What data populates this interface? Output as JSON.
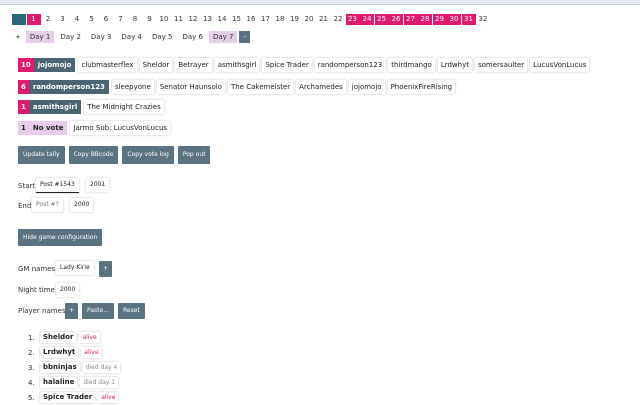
{
  "pages": [
    "1",
    "1",
    "2",
    "3",
    "4",
    "5",
    "6",
    "7",
    "8",
    "9",
    "10",
    "11",
    "12",
    "13",
    "14",
    "15",
    "16",
    "17",
    "18",
    "19",
    "20",
    "21",
    "22",
    "23",
    "24",
    "25",
    "26",
    "27",
    "28",
    "29",
    "30",
    "31",
    "32"
  ],
  "days": {
    "plus": "+",
    "minus": "-",
    "items": [
      "Day 1",
      "Day 2",
      "Day 3",
      "Day 4",
      "Day 5",
      "Day 6",
      "Day 7"
    ]
  },
  "votes": [
    {
      "count": "10",
      "target": "jojomojo",
      "voters": [
        "clubmasterflex",
        "Sheldor",
        "Betrayer",
        "asmithsgirl",
        "Spice Trader",
        "randomperson123",
        "thirdmango",
        "Lrdwhyt",
        "somersaulter",
        "LucusVonLucus"
      ]
    },
    {
      "count": "6",
      "target": "randomperson123",
      "voters": [
        "sleepyone",
        "Senator Haunsolo",
        "The Cakemeister",
        "Archamedes",
        "jojomojo",
        "PhoenixFireRising"
      ]
    },
    {
      "count": "1",
      "target": "asmithsgirl",
      "voters": [
        "The Midnight Crazies"
      ]
    },
    {
      "count": "1",
      "target": "No vote",
      "voters": [
        "Jarmo Sub: LucusVonLucus"
      ]
    }
  ],
  "buttons": {
    "update": "Update tally",
    "bbcode": "Copy BBcode",
    "votelog": "Copy vote log",
    "popout": "Pop out"
  },
  "start": {
    "label": "Start",
    "post": "Post #1543",
    "time": "2001"
  },
  "end": {
    "label": "End",
    "post": "Post #?",
    "time": "2000"
  },
  "hide_config": "Hide game configuration",
  "gm": {
    "label": "GM names",
    "value": "Lady Kirie",
    "add": "+"
  },
  "night": {
    "label": "Night time",
    "value": "2000"
  },
  "players": {
    "label": "Player names",
    "add": "+",
    "paste": "Paste...",
    "reset": "Reset",
    "list": [
      {
        "n": "1.",
        "name": "Sheldor",
        "status": "alive"
      },
      {
        "n": "2.",
        "name": "Lrdwhyt",
        "status": "alive"
      },
      {
        "n": "3.",
        "name": "bbninjas",
        "status": "died day 4"
      },
      {
        "n": "4.",
        "name": "halaline",
        "status": "died day 1"
      },
      {
        "n": "5.",
        "name": "Spice Trader",
        "status": "alive"
      }
    ]
  }
}
